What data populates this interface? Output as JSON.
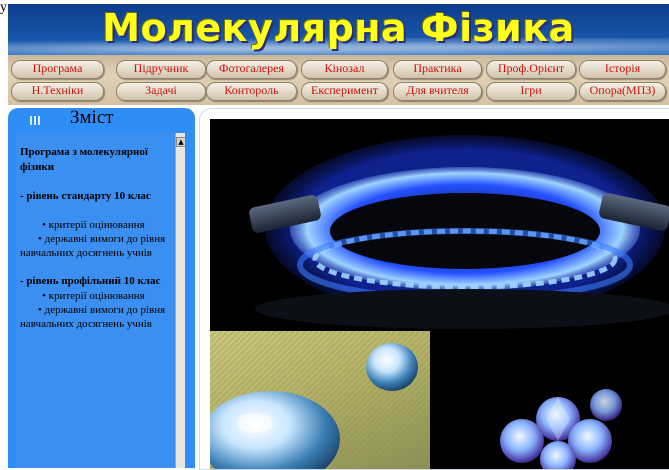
{
  "page_top_text": "у",
  "header": {
    "title": "Молекулярна Фізика",
    "nav_row1": [
      "Програмa",
      "Підручник",
      "Фотогалерея",
      "Кінозал",
      "Практика",
      "Проф.Орієнт",
      "Історія"
    ],
    "nav_row2": [
      "Н.Техніки",
      "Задачі",
      "Контороль",
      "Експеримент",
      "Для вчителя",
      "Ігри",
      "Опора(МПЗ)"
    ]
  },
  "sidebar": {
    "title": "Зміст",
    "sections": [
      {
        "heading": "Програма з молекулярної фізики",
        "items": []
      },
      {
        "heading": "- рівень стандарту 10 клас",
        "items": [
          "• критерії оцінювання",
          "• державні вимоги до рівня навчальних досягнень учнів"
        ]
      },
      {
        "heading": "- рівень профільний 10 клас",
        "items": [
          "• критерії оцінювання",
          "• державні вимоги до рівня навчальних досягнень учнів"
        ]
      }
    ]
  },
  "icons": {
    "sidebar_grip": "grip-icon",
    "scroll_up": "scroll-up-arrow-icon"
  },
  "colors": {
    "nav_text": "#cc1111",
    "title": "#ffff1a",
    "sidebar_bg": "#2f8ef5"
  }
}
